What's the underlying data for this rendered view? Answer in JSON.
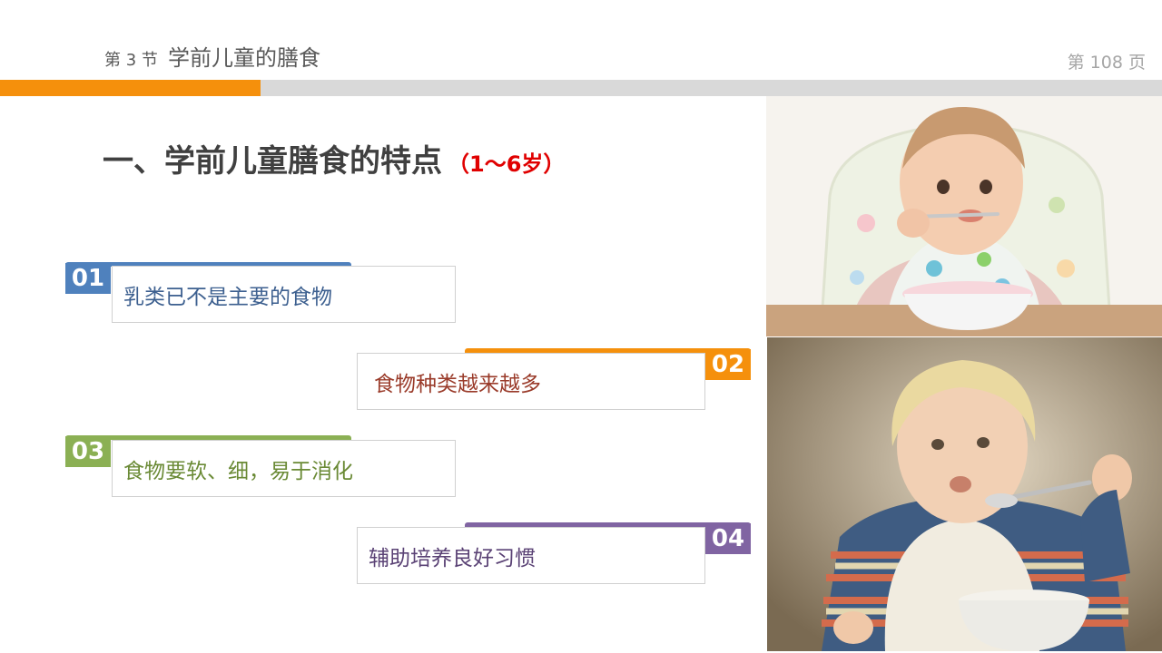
{
  "header": {
    "section_label": "第 3 节",
    "section_title": "学前儿童的膳食",
    "page_number": "第 108 页"
  },
  "main": {
    "title": "一、学前儿童膳食的特点",
    "age_range": "（1～6岁）"
  },
  "items": [
    {
      "number": "01",
      "text": "乳类已不是主要的食物",
      "color": "#4f81bd"
    },
    {
      "number": "02",
      "text": "食物种类越来越多",
      "color": "#f5900c"
    },
    {
      "number": "03",
      "text": "食物要软、细，易于消化",
      "color": "#8bb054"
    },
    {
      "number": "04",
      "text": "辅助培养良好习惯",
      "color": "#8064a2"
    }
  ],
  "colors": {
    "accent_orange": "#f5900c",
    "bar_gray": "#d9d9d9",
    "title_red": "#e00000"
  },
  "photos": [
    {
      "subject": "baby-eating-in-high-chair"
    },
    {
      "subject": "toddler-eating-with-spoon"
    }
  ]
}
